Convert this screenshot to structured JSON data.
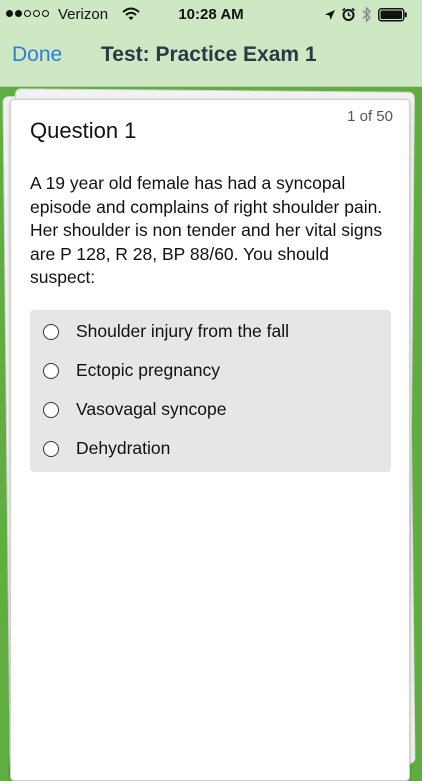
{
  "status_bar": {
    "carrier": "Verizon",
    "time": "10:28 AM",
    "signal_bars_filled": 2,
    "signal_bars_total": 5
  },
  "nav": {
    "done_label": "Done",
    "title": "Test: Practice Exam 1"
  },
  "question": {
    "counter": "1 of 50",
    "title": "Question 1",
    "text": "A 19 year old female has had a syncopal episode and complains of right shoulder pain. Her shoulder is non tender and her vital signs are P 128, R 28, BP 88/60. You should suspect:",
    "options": [
      {
        "label": "Shoulder injury from the fall"
      },
      {
        "label": "Ectopic pregnancy"
      },
      {
        "label": "Vasovagal syncope"
      },
      {
        "label": "Dehydration"
      }
    ]
  },
  "colors": {
    "accent": "#2d7fd6",
    "background": "#5fae3f",
    "nav_background": "#cfe8c4"
  },
  "icons": [
    "wifi-icon",
    "location-icon",
    "alarm-icon",
    "bluetooth-icon",
    "battery-icon",
    "radio-icon"
  ]
}
